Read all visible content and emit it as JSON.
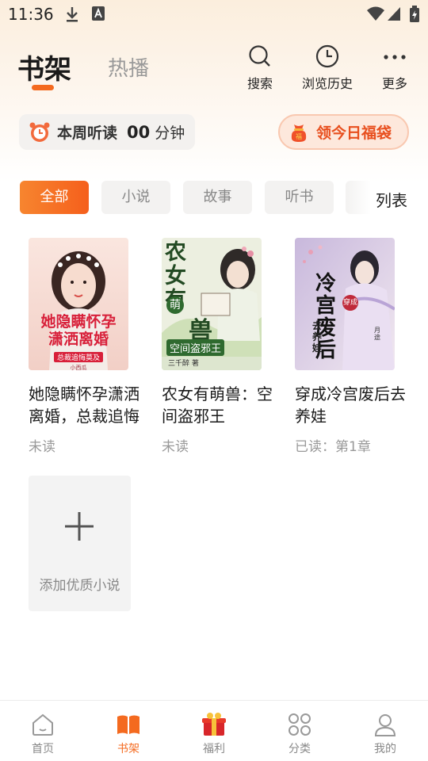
{
  "status_bar": {
    "time": "11:36",
    "icons": [
      "download-icon",
      "font-a-icon",
      "wifi-icon",
      "signal-icon",
      "battery-icon"
    ]
  },
  "header": {
    "tabs": [
      {
        "label": "书架",
        "active": true
      },
      {
        "label": "热播",
        "active": false
      }
    ],
    "actions": [
      {
        "icon": "search-icon",
        "label": "搜索"
      },
      {
        "icon": "history-icon",
        "label": "浏览历史"
      },
      {
        "icon": "more-icon",
        "label": "更多"
      }
    ]
  },
  "listen_stats": {
    "label": "本周听读",
    "count": "00",
    "unit": "分钟"
  },
  "gift": {
    "label": "领今日福袋",
    "icon": "lucky-bag-icon"
  },
  "categories": [
    {
      "label": "全部",
      "active": true
    },
    {
      "label": "小说",
      "active": false
    },
    {
      "label": "故事",
      "active": false
    },
    {
      "label": "听书",
      "active": false
    }
  ],
  "list_toggle": "列表",
  "books": [
    {
      "title": "她隐瞒怀孕潇洒离婚，总裁追悔",
      "status": "未读",
      "cover_text": [
        "她隐瞒怀孕",
        "潇洒离婚",
        "总裁追悔莫及",
        "小西瓜"
      ],
      "cover_colors": {
        "bg": "#f6dcd6",
        "text": "#d8203a"
      }
    },
    {
      "title": "农女有萌兽：空间盗邪王",
      "status": "未读",
      "cover_text": [
        "农女有",
        "萌",
        "兽",
        "空间盗邪王",
        "三千醉 著"
      ],
      "cover_colors": {
        "bg": "#e9eddc",
        "text": "#2a5a2a"
      }
    },
    {
      "title": "穿成冷宫废后去养娃",
      "status": "已读：第1章",
      "cover_text": [
        "冷宫废后",
        "穿成",
        "去养娃",
        "月途"
      ],
      "cover_colors": {
        "bg": "#e8e2ef",
        "text": "#222"
      }
    }
  ],
  "add_tile": {
    "label": "添加优质小说"
  },
  "bottom_nav": [
    {
      "label": "首页",
      "icon": "home-icon",
      "active": false
    },
    {
      "label": "书架",
      "icon": "bookshelf-icon",
      "active": true
    },
    {
      "label": "福利",
      "icon": "welfare-icon",
      "active": false
    },
    {
      "label": "分类",
      "icon": "category-icon",
      "active": false
    },
    {
      "label": "我的",
      "icon": "profile-icon",
      "active": false
    }
  ],
  "colors": {
    "accent": "#f46a1f",
    "gift_text": "#e84f1e",
    "muted": "#999999"
  }
}
